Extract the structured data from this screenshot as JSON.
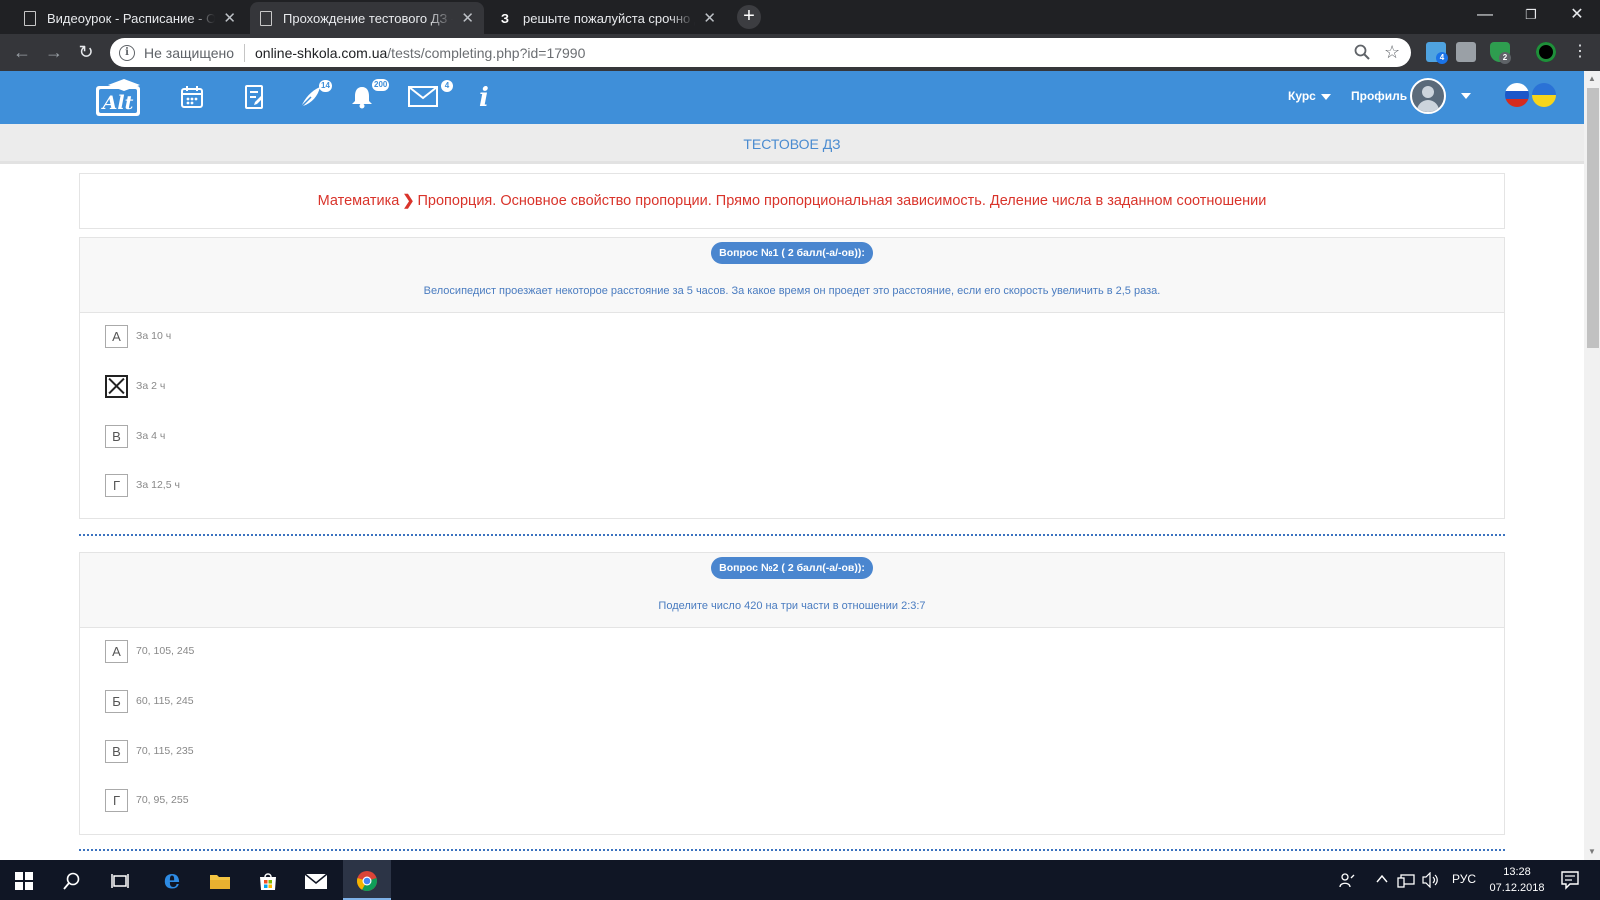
{
  "browser": {
    "tabs": [
      {
        "title": "Видеоурок - Расписание - Онла",
        "active": false
      },
      {
        "title": "Прохождение тестового ДЗ - О",
        "active": true
      },
      {
        "title": "решыте пожалуйста срочно да",
        "active": false,
        "favicon_letter": "З"
      }
    ],
    "new_tab": "+",
    "security_label": "Не защищено",
    "url_host": "online-shkola.com.ua",
    "url_path": "/tests/completing.php?id=17990",
    "ext_badges": [
      "4",
      "2"
    ]
  },
  "site": {
    "badges": {
      "homework": "14",
      "notifications": "200",
      "messages": "4"
    },
    "info_icon": "i",
    "course_label": "Курс",
    "profile_label": "Профиль",
    "page_title": "ТЕСТОВОЕ ДЗ",
    "breadcrumb": {
      "subject": "Математика",
      "topic": "Пропорция. Основное свойство пропорции. Прямо пропорциональная зависимость. Деление числа в заданном соотношении"
    }
  },
  "questions": [
    {
      "label": "Вопрос №1 ( 2 балл(-а/-ов)):",
      "text": "Велосипедист проезжает некоторое расстояние за 5 часов. За какое время он проедет это расстояние, если его скорость увеличить в 2,5 раза.",
      "answers": [
        {
          "letter": "А",
          "text": "За 10 ч",
          "checked": false
        },
        {
          "letter": "Б",
          "text": "За 2 ч",
          "checked": true
        },
        {
          "letter": "В",
          "text": "За 4 ч",
          "checked": false
        },
        {
          "letter": "Г",
          "text": "За 12,5 ч",
          "checked": false
        }
      ]
    },
    {
      "label": "Вопрос №2 ( 2 балл(-а/-ов)):",
      "text": "Поделите число 420 на три части в отношении 2:3:7",
      "answers": [
        {
          "letter": "А",
          "text": "70, 105, 245",
          "checked": false
        },
        {
          "letter": "Б",
          "text": "60, 115, 245",
          "checked": false
        },
        {
          "letter": "В",
          "text": "70, 115, 235",
          "checked": false
        },
        {
          "letter": "Г",
          "text": "70, 95, 255",
          "checked": false
        }
      ]
    }
  ],
  "taskbar": {
    "language": "РУС",
    "time": "13:28",
    "date": "07.12.2018"
  },
  "colors": {
    "header_blue": "#3f8fd9",
    "breadcrumb_red": "#d9342b",
    "question_pill": "#4a86cf",
    "question_text": "#4a7cc0"
  }
}
